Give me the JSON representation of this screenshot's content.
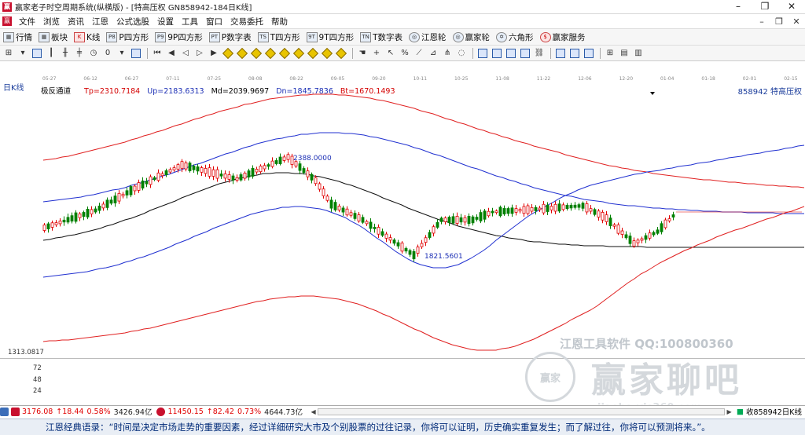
{
  "window": {
    "title": "赢家老子时空周期系统(纵横版) - [特高压权  GN858942-184日K线]",
    "controls": [
      "–",
      "❐",
      "✕"
    ]
  },
  "menu": {
    "items": [
      "文件",
      "浏览",
      "资讯",
      "江恩",
      "公式选股",
      "设置",
      "工具",
      "窗口",
      "交易委托",
      "帮助"
    ],
    "right": [
      "–",
      "❐",
      "✕"
    ]
  },
  "toolbar1": [
    {
      "label": "行情",
      "icon": "grid"
    },
    {
      "label": "板块",
      "icon": "grid"
    },
    {
      "label": "K线",
      "icon": "K"
    },
    {
      "label": "P四方形",
      "icon": "P8"
    },
    {
      "label": "9P四方形",
      "icon": "P9"
    },
    {
      "label": "P数字表",
      "icon": "PT"
    },
    {
      "label": "T四方形",
      "icon": "TS"
    },
    {
      "label": "9T四方形",
      "icon": "9T"
    },
    {
      "label": "T数字表",
      "icon": "TN"
    },
    {
      "label": "江恩轮",
      "icon": "wheel"
    },
    {
      "label": "赢家轮",
      "icon": "wheel"
    },
    {
      "label": "六角形",
      "icon": "hex"
    },
    {
      "label": "赢家服务",
      "icon": "globe"
    }
  ],
  "chart": {
    "period_label": "日K线",
    "indicator_name": "极反通道",
    "indicator_values": [
      {
        "text": "Tp=2310.7184",
        "color": "#d40000"
      },
      {
        "text": "Up=2183.6313",
        "color": "#1c2fb5"
      },
      {
        "text": "Md=2039.9697",
        "color": "#000000"
      },
      {
        "text": "Dn=1845.7836",
        "color": "#1c2fb5"
      },
      {
        "text": "Bt=1670.1493",
        "color": "#d40000"
      }
    ],
    "code_label": "858942  特高压权",
    "high_label": "2388.0000",
    "low_label": "1821.5601",
    "axis_value": "1313.0817",
    "volume_ticks": [
      "72",
      "48",
      "24"
    ],
    "dates": [
      "05-27",
      "06-12",
      "06-27",
      "07-11",
      "07-25",
      "08-08",
      "08-22",
      "09-05",
      "09-20",
      "10-11",
      "10-25",
      "11-08",
      "11-22",
      "12-06",
      "12-20",
      "01-04",
      "01-18",
      "02-01",
      "02-15"
    ]
  },
  "watermark": {
    "line1": "江恩工具软件  QQ:100800360",
    "brand": "赢家聊吧",
    "site": "jiaoba.yjs360.com",
    "seal": "赢家"
  },
  "statusbar": {
    "sh_index": "3176.08",
    "sh_change": "↑18.44",
    "sh_pct": "0.58%",
    "sh_amount": "3426.94亿",
    "sz_index": "11450.15",
    "sz_change": "↑82.42",
    "sz_pct": "0.73%",
    "sz_amount": "4644.73亿",
    "right_text": "收858942日K线"
  },
  "quote": {
    "text": "江恩经典语录：“时间是决定市场走势的重要因素，经过详细研究大市及个别股票的过往记录，你将可以证明，历史确实重复发生；而了解过往，你将可以预测将来。”。"
  },
  "colors": {
    "up": "#e00000",
    "down": "#008000",
    "outer_band": "#e02020",
    "inner_band": "#2030d0",
    "mid_line": "#111111"
  }
}
